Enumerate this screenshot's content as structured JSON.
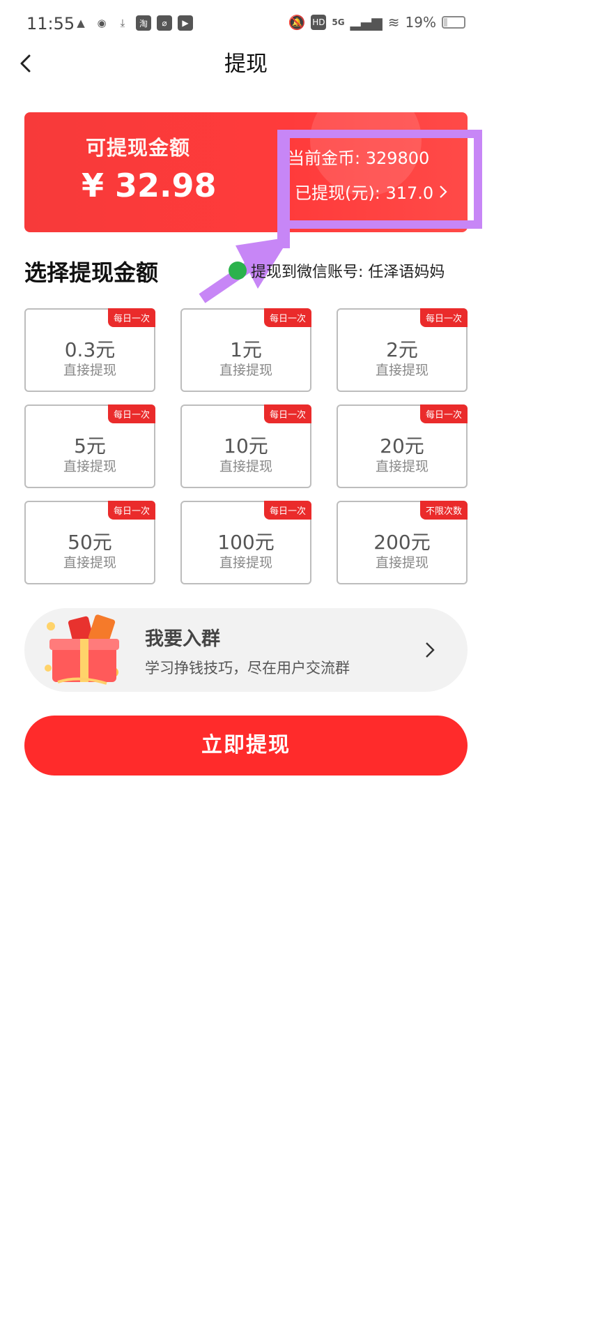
{
  "status_bar": {
    "time": "11:55",
    "battery_text": "19%",
    "network": "5G",
    "battery_level": 0.19,
    "left_icons": [
      "qq-icon",
      "wechat-icon",
      "download-icon",
      "taobao-icon",
      "app-icon",
      "video-icon"
    ]
  },
  "header": {
    "title": "提现"
  },
  "balance_card": {
    "label": "可提现金额",
    "amount": "¥ 32.98",
    "coins": "当前金币: 329800",
    "withdrawn": "已提现(元): 317.0"
  },
  "section": {
    "title": "选择提现金额",
    "wechat_account": "提现到微信账号: 任泽语妈妈"
  },
  "options": [
    {
      "amount": "0.3元",
      "subtitle": "直接提现",
      "badge": "每日一次"
    },
    {
      "amount": "1元",
      "subtitle": "直接提现",
      "badge": "每日一次"
    },
    {
      "amount": "2元",
      "subtitle": "直接提现",
      "badge": "每日一次"
    },
    {
      "amount": "5元",
      "subtitle": "直接提现",
      "badge": "每日一次"
    },
    {
      "amount": "10元",
      "subtitle": "直接提现",
      "badge": "每日一次"
    },
    {
      "amount": "20元",
      "subtitle": "直接提现",
      "badge": "每日一次"
    },
    {
      "amount": "50元",
      "subtitle": "直接提现",
      "badge": "每日一次"
    },
    {
      "amount": "100元",
      "subtitle": "直接提现",
      "badge": "每日一次"
    },
    {
      "amount": "200元",
      "subtitle": "直接提现",
      "badge": "不限次数"
    }
  ],
  "group_banner": {
    "title": "我要入群",
    "subtitle": "学习挣钱技巧，尽在用户交流群"
  },
  "primary_button": {
    "label": "立即提现"
  },
  "colors": {
    "accent_red": "#ff2b2b",
    "highlight_purple": "#c786f6",
    "wechat_green": "#2bb24c"
  }
}
